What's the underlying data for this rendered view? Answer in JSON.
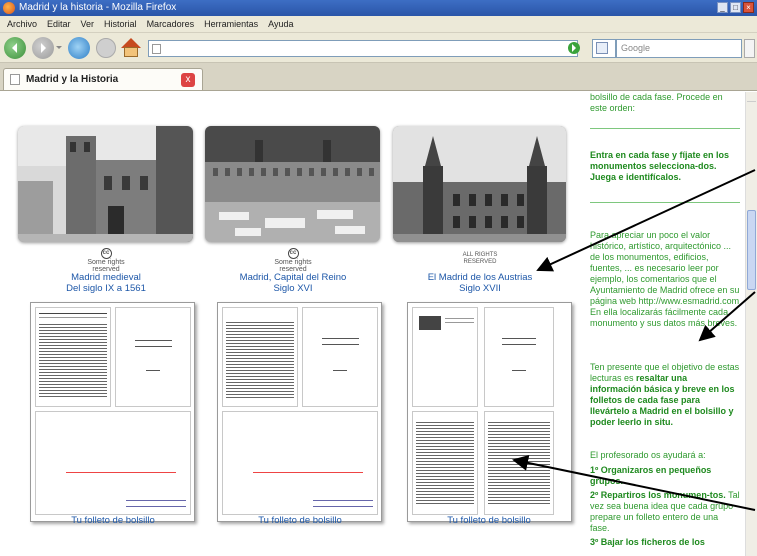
{
  "window": {
    "title": "Madrid y la historia - Mozilla Firefox"
  },
  "menu": [
    "Archivo",
    "Editar",
    "Ver",
    "Historial",
    "Marcadores",
    "Herramientas",
    "Ayuda"
  ],
  "toolbar": {
    "url": "",
    "search_placeholder": "Google"
  },
  "tab": {
    "label": "Madrid y la Historia",
    "close_label": "x"
  },
  "gallery": {
    "photos": [
      {
        "icon": "photo-medieval-church"
      },
      {
        "icon": "photo-plaza-mayor"
      },
      {
        "icon": "photo-casa-de-la-villa"
      }
    ],
    "badges": [
      {
        "symbol": "cc",
        "text": "Some rights reserved"
      },
      {
        "symbol": "cc",
        "text": "Some rights reserved"
      },
      {
        "symbol": "",
        "text": "ALL RIGHTS RESERVED"
      }
    ],
    "captions": [
      {
        "line1": "Madrid medieval",
        "line2": "Del siglo IX a 1561"
      },
      {
        "line1": "Madrid, Capital del Reino",
        "line2": "Siglo XVI"
      },
      {
        "line1": "El Madrid de los Austrias",
        "line2": "Siglo XVII"
      }
    ],
    "leaflet_captions": [
      "Tu folleto de bolsillo",
      "Tu folleto de bolsillo",
      "Tu folleto de bolsillo"
    ]
  },
  "sidebar": {
    "p1": "bolsillo de cada fase. Procede en este orden:",
    "p2_bold": "Entra en cada fase y fíjate en los monumentos selecciona-dos. Juega e identifícalos.",
    "p3": "Para apreciar un poco el valor histórico, artístico, arquitectónico ... de los monumentos, edificios, fuentes, ... es necesario leer por ejemplo, los comentarios que el Ayuntamiento de Madrid ofrece en su página web http://www.esmadrid.com En ella localizarás fácilmente cada monumento y sus datos más breves.",
    "p4_start": "Ten presente que el objetivo de estas lecturas es",
    "p4_bold": "resaltar una información básica y breve en los folletos de cada fase para llevártelo a Madrid en el bolsillo y poder leerlo in situ.",
    "p5": "El profesorado os ayudará a:",
    "p6_bold": "1º Organizaros en pequeños grupos.",
    "p7_bold": "2º Repartiros los monumen-tos.",
    "p7": "Tal vez sea buena idea que cada grupo prepare un folleto entero de una fase.",
    "p8_bold": "3º Bajar los ficheros de los"
  },
  "colors": {
    "link": "#1d57a8",
    "sidebar_text": "#2f9a2f",
    "chrome": "#ece9d8"
  }
}
